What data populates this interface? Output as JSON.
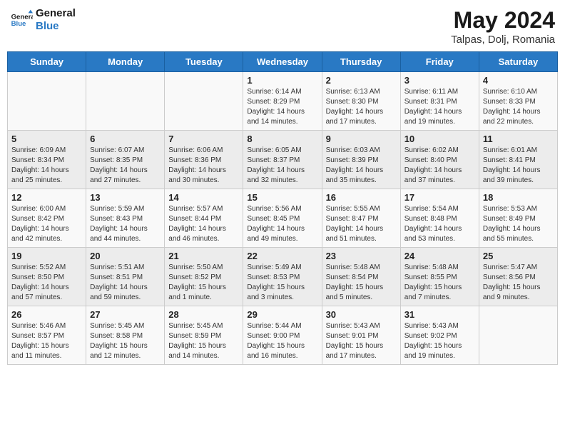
{
  "header": {
    "logo_line1": "General",
    "logo_line2": "Blue",
    "title": "May 2024",
    "subtitle": "Talpas, Dolj, Romania"
  },
  "weekdays": [
    "Sunday",
    "Monday",
    "Tuesday",
    "Wednesday",
    "Thursday",
    "Friday",
    "Saturday"
  ],
  "weeks": [
    [
      {
        "day": "",
        "info": ""
      },
      {
        "day": "",
        "info": ""
      },
      {
        "day": "",
        "info": ""
      },
      {
        "day": "1",
        "info": "Sunrise: 6:14 AM\nSunset: 8:29 PM\nDaylight: 14 hours\nand 14 minutes."
      },
      {
        "day": "2",
        "info": "Sunrise: 6:13 AM\nSunset: 8:30 PM\nDaylight: 14 hours\nand 17 minutes."
      },
      {
        "day": "3",
        "info": "Sunrise: 6:11 AM\nSunset: 8:31 PM\nDaylight: 14 hours\nand 19 minutes."
      },
      {
        "day": "4",
        "info": "Sunrise: 6:10 AM\nSunset: 8:33 PM\nDaylight: 14 hours\nand 22 minutes."
      }
    ],
    [
      {
        "day": "5",
        "info": "Sunrise: 6:09 AM\nSunset: 8:34 PM\nDaylight: 14 hours\nand 25 minutes."
      },
      {
        "day": "6",
        "info": "Sunrise: 6:07 AM\nSunset: 8:35 PM\nDaylight: 14 hours\nand 27 minutes."
      },
      {
        "day": "7",
        "info": "Sunrise: 6:06 AM\nSunset: 8:36 PM\nDaylight: 14 hours\nand 30 minutes."
      },
      {
        "day": "8",
        "info": "Sunrise: 6:05 AM\nSunset: 8:37 PM\nDaylight: 14 hours\nand 32 minutes."
      },
      {
        "day": "9",
        "info": "Sunrise: 6:03 AM\nSunset: 8:39 PM\nDaylight: 14 hours\nand 35 minutes."
      },
      {
        "day": "10",
        "info": "Sunrise: 6:02 AM\nSunset: 8:40 PM\nDaylight: 14 hours\nand 37 minutes."
      },
      {
        "day": "11",
        "info": "Sunrise: 6:01 AM\nSunset: 8:41 PM\nDaylight: 14 hours\nand 39 minutes."
      }
    ],
    [
      {
        "day": "12",
        "info": "Sunrise: 6:00 AM\nSunset: 8:42 PM\nDaylight: 14 hours\nand 42 minutes."
      },
      {
        "day": "13",
        "info": "Sunrise: 5:59 AM\nSunset: 8:43 PM\nDaylight: 14 hours\nand 44 minutes."
      },
      {
        "day": "14",
        "info": "Sunrise: 5:57 AM\nSunset: 8:44 PM\nDaylight: 14 hours\nand 46 minutes."
      },
      {
        "day": "15",
        "info": "Sunrise: 5:56 AM\nSunset: 8:45 PM\nDaylight: 14 hours\nand 49 minutes."
      },
      {
        "day": "16",
        "info": "Sunrise: 5:55 AM\nSunset: 8:47 PM\nDaylight: 14 hours\nand 51 minutes."
      },
      {
        "day": "17",
        "info": "Sunrise: 5:54 AM\nSunset: 8:48 PM\nDaylight: 14 hours\nand 53 minutes."
      },
      {
        "day": "18",
        "info": "Sunrise: 5:53 AM\nSunset: 8:49 PM\nDaylight: 14 hours\nand 55 minutes."
      }
    ],
    [
      {
        "day": "19",
        "info": "Sunrise: 5:52 AM\nSunset: 8:50 PM\nDaylight: 14 hours\nand 57 minutes."
      },
      {
        "day": "20",
        "info": "Sunrise: 5:51 AM\nSunset: 8:51 PM\nDaylight: 14 hours\nand 59 minutes."
      },
      {
        "day": "21",
        "info": "Sunrise: 5:50 AM\nSunset: 8:52 PM\nDaylight: 15 hours\nand 1 minute."
      },
      {
        "day": "22",
        "info": "Sunrise: 5:49 AM\nSunset: 8:53 PM\nDaylight: 15 hours\nand 3 minutes."
      },
      {
        "day": "23",
        "info": "Sunrise: 5:48 AM\nSunset: 8:54 PM\nDaylight: 15 hours\nand 5 minutes."
      },
      {
        "day": "24",
        "info": "Sunrise: 5:48 AM\nSunset: 8:55 PM\nDaylight: 15 hours\nand 7 minutes."
      },
      {
        "day": "25",
        "info": "Sunrise: 5:47 AM\nSunset: 8:56 PM\nDaylight: 15 hours\nand 9 minutes."
      }
    ],
    [
      {
        "day": "26",
        "info": "Sunrise: 5:46 AM\nSunset: 8:57 PM\nDaylight: 15 hours\nand 11 minutes."
      },
      {
        "day": "27",
        "info": "Sunrise: 5:45 AM\nSunset: 8:58 PM\nDaylight: 15 hours\nand 12 minutes."
      },
      {
        "day": "28",
        "info": "Sunrise: 5:45 AM\nSunset: 8:59 PM\nDaylight: 15 hours\nand 14 minutes."
      },
      {
        "day": "29",
        "info": "Sunrise: 5:44 AM\nSunset: 9:00 PM\nDaylight: 15 hours\nand 16 minutes."
      },
      {
        "day": "30",
        "info": "Sunrise: 5:43 AM\nSunset: 9:01 PM\nDaylight: 15 hours\nand 17 minutes."
      },
      {
        "day": "31",
        "info": "Sunrise: 5:43 AM\nSunset: 9:02 PM\nDaylight: 15 hours\nand 19 minutes."
      },
      {
        "day": "",
        "info": ""
      }
    ]
  ]
}
